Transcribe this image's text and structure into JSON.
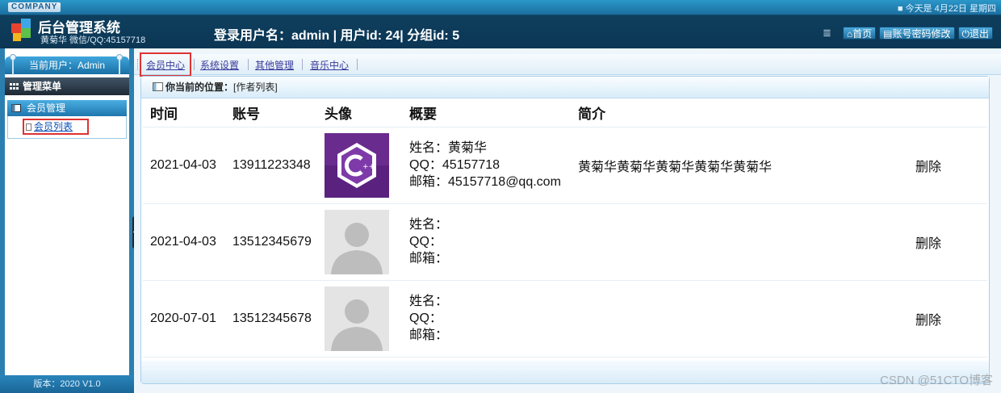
{
  "header": {
    "company_badge": "COMPANY",
    "date_text": "■ 今天是 4月22日  星期四",
    "system_title": "后台管理系统",
    "system_subtitle": "黄菊华 微信/QQ:45157718",
    "login_info": "登录用户名：admin | 用户id: 24| 分组id: 5",
    "menu_glyph": "≣",
    "buttons": [
      {
        "label": "⌂首页"
      },
      {
        "label": "▤账号密码修改"
      },
      {
        "label": "⏻退出"
      }
    ]
  },
  "sidebar": {
    "current_user": "当前用户：Admin",
    "menu_title": "管理菜单",
    "section_title": "会员管理",
    "items": [
      {
        "label": "会员列表"
      }
    ],
    "version": "版本：2020 V1.0",
    "collapse_glyph": "◀"
  },
  "tabs": [
    {
      "label": "会员中心",
      "active": true
    },
    {
      "label": "系统设置"
    },
    {
      "label": "其他管理"
    },
    {
      "label": "音乐中心"
    }
  ],
  "breadcrumb": {
    "label": "你当前的位置：",
    "value": "[作者列表]"
  },
  "table": {
    "headers": [
      "时间",
      "账号",
      "头像",
      "概要",
      "简介",
      ""
    ],
    "rows": [
      {
        "time": "2021-04-03",
        "account": "13911223348",
        "avatar": "cpp-logo-icon",
        "name": "姓名：黄菊华",
        "qq": "QQ：45157718",
        "email": "邮箱：45157718@qq.com",
        "intro": "黄菊华黄菊华黄菊华黄菊华黄菊华",
        "action": "删除"
      },
      {
        "time": "2021-04-03",
        "account": "13512345679",
        "avatar": "default-user-icon",
        "name": "姓名：",
        "qq": "QQ：",
        "email": "邮箱：",
        "intro": "",
        "action": "删除"
      },
      {
        "time": "2020-07-01",
        "account": "13512345678",
        "avatar": "default-user-icon",
        "name": "姓名：",
        "qq": "QQ：",
        "email": "邮箱：",
        "intro": "",
        "action": "删除"
      }
    ]
  },
  "watermark": "CSDN @51CTO博客",
  "colors": {
    "frame_blue": "#2a7fb0",
    "header_dark": "#0b3654",
    "highlight_red": "#dd3333",
    "cpp_purple": "#6a2b8e"
  }
}
